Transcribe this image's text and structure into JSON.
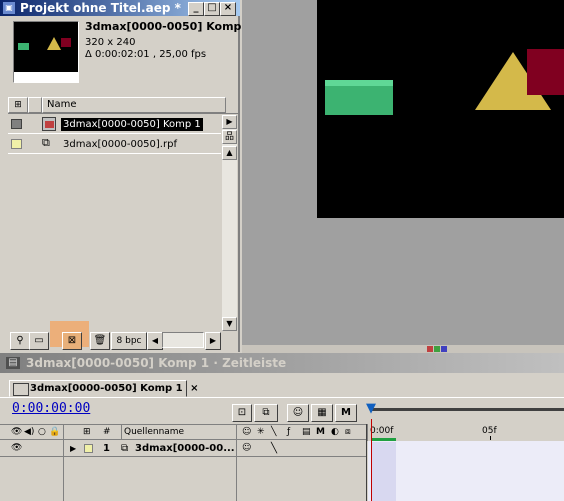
{
  "project": {
    "title": "Projekt ohne Titel.aep *",
    "comp_name": "3dmax[0000-0050] Komp 1",
    "dimensions": "320 x 240",
    "duration": "Δ 0:00:02:01 , 25,00 fps",
    "col_name": "Name",
    "items": [
      {
        "name": "3dmax[0000-0050] Komp 1",
        "label_color": "#808080",
        "selected": true
      },
      {
        "name": "3dmax[0000-0050].rpf",
        "label_color": "#f0f0a8",
        "selected": false
      }
    ],
    "bpc": "8 bpc"
  },
  "timeline": {
    "title": "3dmax[0000-0050] Komp 1 · Zeitleiste",
    "tab": "3dmax[0000-0050] Komp 1",
    "timecode": "0:00:00:00",
    "col_number": "#",
    "col_source": "Quellenname",
    "ruler": {
      "start": "0:00f",
      "mark": "05f"
    },
    "layer": {
      "index": "1",
      "name": "3dmax[0000-00..."
    }
  },
  "colors": {
    "accent_blue": "#0a246a",
    "timecode": "#0000c0",
    "highlight_orange": "#f4a460",
    "box_green": "#3cb371",
    "cone_gold": "#d4b94a",
    "box_red": "#800020"
  },
  "icons": [
    "graph-icon",
    "find-icon",
    "folder-icon",
    "new-comp-icon",
    "trash-icon",
    "eye-icon",
    "audio-icon",
    "solo-icon",
    "lock-icon",
    "shy-icon",
    "collapse-icon",
    "quality-icon",
    "effect-icon",
    "frame-blend-icon",
    "motion-blur-icon",
    "adjustment-icon",
    "3d-layer-icon",
    "comp-icon"
  ]
}
